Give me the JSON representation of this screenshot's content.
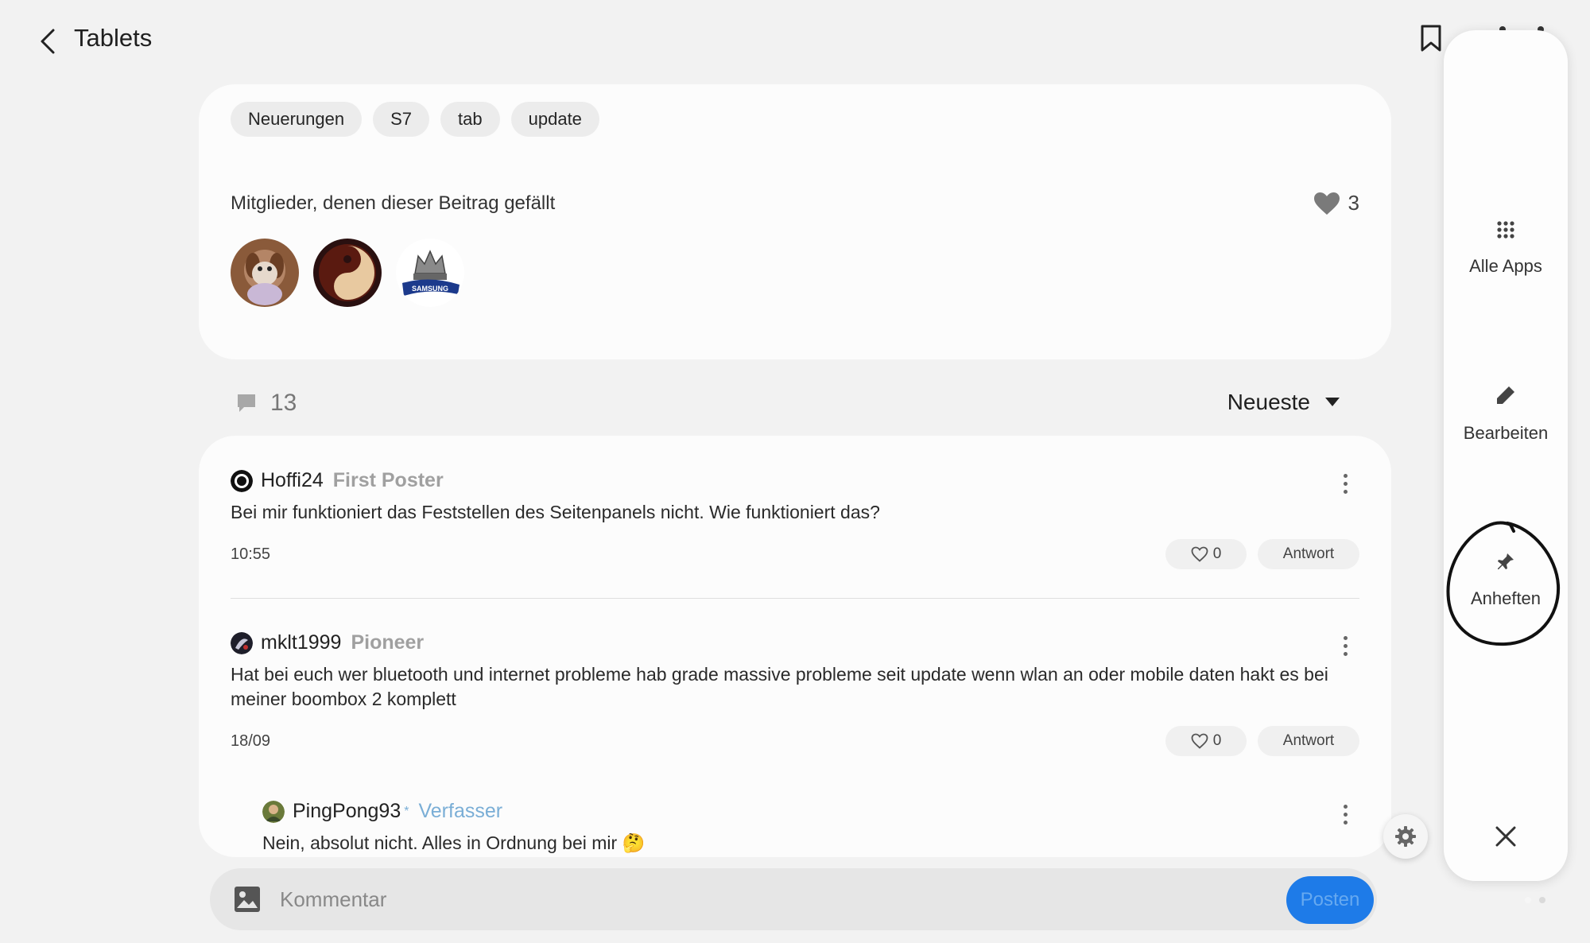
{
  "header": {
    "title": "Tablets"
  },
  "post": {
    "tags": [
      "Neuerungen",
      "S7",
      "tab",
      "update"
    ],
    "likes_title": "Mitglieder, denen dieser Beitrag gefällt",
    "likes_count": "3"
  },
  "comments_section": {
    "count": "13",
    "sort_label": "Neueste",
    "comments": [
      {
        "author": "Hoffi24",
        "badge": "First Poster",
        "text": "Bei mir funktioniert das Feststellen des Seitenpanels nicht. Wie funktioniert das?",
        "time": "10:55",
        "likes": "0",
        "reply_label": "Antwort"
      },
      {
        "author": "mklt1999",
        "badge": "Pioneer",
        "text": "Hat bei euch wer bluetooth und internet probleme hab grade massive probleme seit update wenn wlan an oder mobile daten hakt es bei meiner boombox 2 komplett",
        "time": "18/09",
        "likes": "0",
        "reply_label": "Antwort"
      },
      {
        "author": "PingPong93",
        "author_mark": "*",
        "badge": "Verfasser",
        "text": "Nein, absolut nicht. Alles in Ordnung bei mir 🤔"
      }
    ]
  },
  "composer": {
    "placeholder": "Kommentar",
    "post_label": "Posten"
  },
  "edge_panel": {
    "items": [
      {
        "label": "Alle Apps",
        "icon": "grid-icon"
      },
      {
        "label": "Bearbeiten",
        "icon": "pencil-icon"
      },
      {
        "label": "Anheften",
        "icon": "pin-icon"
      }
    ],
    "close_icon": "close-icon"
  },
  "colors": {
    "accent": "#1e7be8",
    "author_badge": "#7aaed6",
    "badge": "#a0a0a0"
  }
}
